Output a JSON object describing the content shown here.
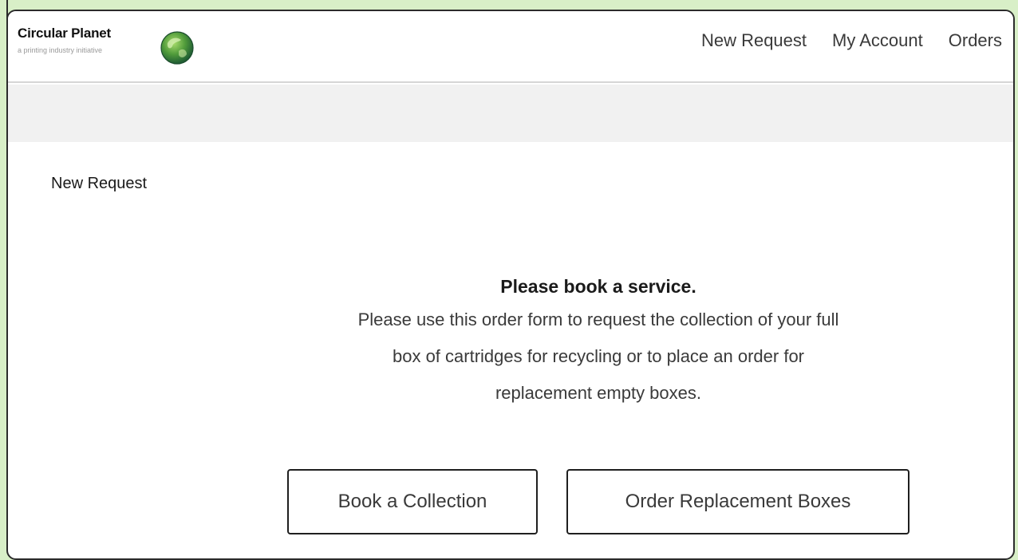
{
  "brand": {
    "name": "Circular Planet",
    "tagline": "a printing industry initiative",
    "logo_icon": "globe-icon",
    "colors": {
      "globe_dark": "#1f6b3a",
      "globe_light": "#7cc242"
    }
  },
  "nav": {
    "items": [
      {
        "label": "New Request"
      },
      {
        "label": "My Account"
      },
      {
        "label": "Orders"
      }
    ]
  },
  "main": {
    "section_title": "New Request",
    "prompt_heading": "Please book a service.",
    "prompt_body": "Please use this order form to request the collection of your full box of cartridges for recycling or to place an order for replacement empty boxes.",
    "actions": {
      "collection_label": "Book a Collection",
      "boxes_label": "Order Replacement Boxes"
    }
  }
}
